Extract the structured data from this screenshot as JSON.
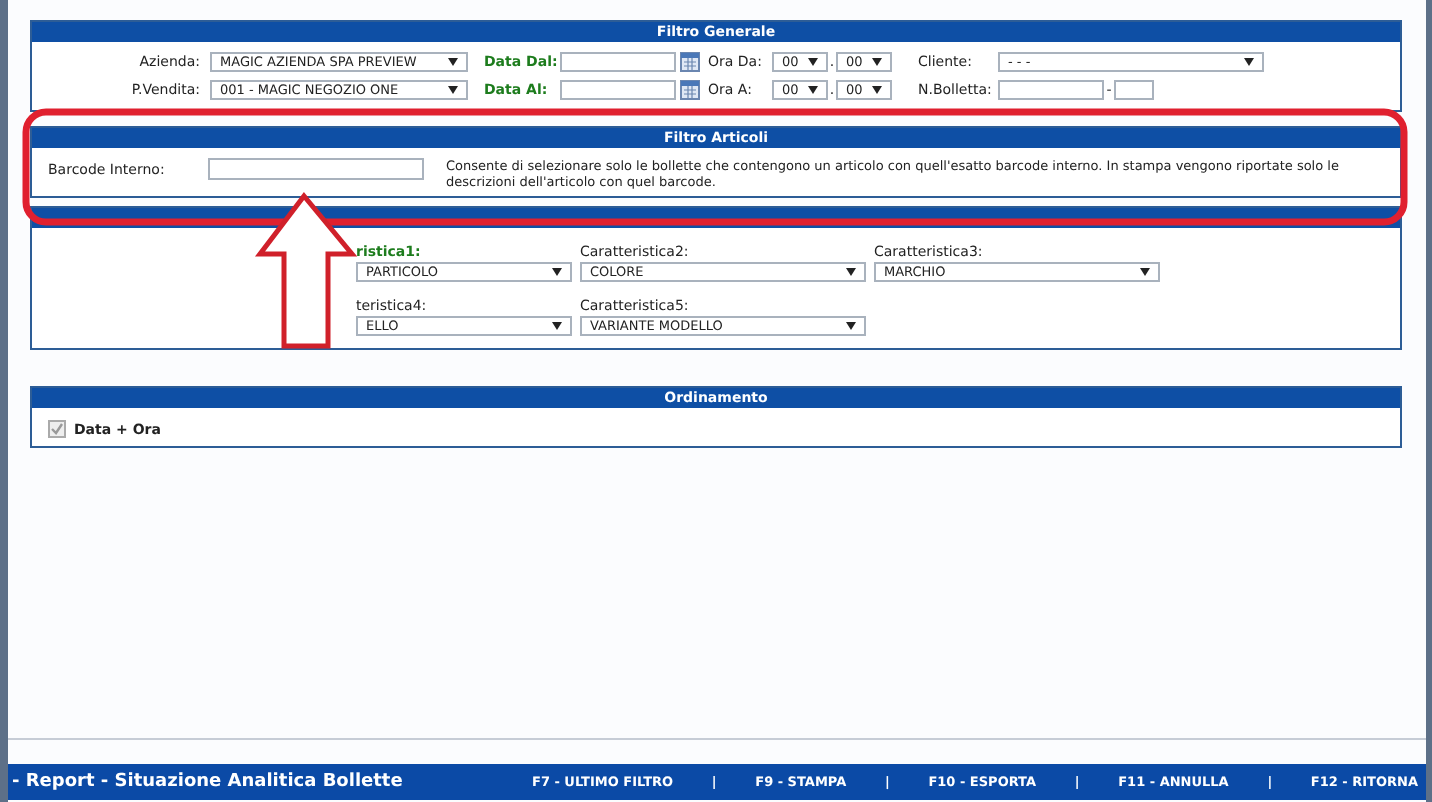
{
  "general_filter": {
    "title": "Filtro Generale",
    "rows": [
      {
        "label": "Azienda:",
        "value": "MAGIC AZIENDA SPA PREVIEW",
        "date_label": "Data Dal:",
        "time_label": "Ora Da:",
        "hour": "00",
        "minute": "00",
        "extra": {
          "kind": "select",
          "label": "Cliente:",
          "value": "- - -"
        }
      },
      {
        "label": "P.Vendita:",
        "value": "001 - MAGIC NEGOZIO ONE",
        "date_label": "Data Al:",
        "time_label": "Ora A:",
        "hour": "00",
        "minute": "00",
        "extra": {
          "kind": "range",
          "label": "N.Bolletta:",
          "separator": "-"
        }
      }
    ],
    "time_separator": "."
  },
  "article_filter": {
    "title": "Filtro Articoli",
    "label": "Barcode Interno:",
    "description": "Consente di selezionare solo le bollette che contengono un articolo con quell'esatto barcode interno. In stampa vengono riportate solo le descrizioni dell'articolo con quel barcode."
  },
  "characteristics": {
    "rows": [
      [
        {
          "label": "ristica1:",
          "value": "PARTICOLO",
          "highlighted": true
        },
        {
          "label": "Caratteristica2:",
          "value": "COLORE",
          "highlighted": false
        },
        {
          "label": "Caratteristica3:",
          "value": "MARCHIO",
          "highlighted": false
        }
      ],
      [
        {
          "label": "teristica4:",
          "value": "ELLO",
          "highlighted": false
        },
        {
          "label": "Caratteristica5:",
          "value": "VARIANTE MODELLO",
          "highlighted": false
        }
      ]
    ]
  },
  "sorting": {
    "title": "Ordinamento",
    "options": [
      {
        "label": "Data + Ora",
        "checked": true,
        "disabled": true
      }
    ]
  },
  "footer": {
    "title": "- Report - Situazione Analitica Bollette",
    "commands": [
      "F7 - ULTIMO FILTRO",
      "F9 - STAMPA",
      "F10 - ESPORTA",
      "F11 - ANNULLA",
      "F12 - RITORNA"
    ],
    "separator": "|"
  }
}
